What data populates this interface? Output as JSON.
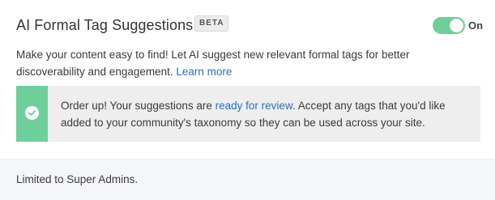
{
  "header": {
    "title": "AI Formal Tag Suggestions",
    "badge": "BETA",
    "toggle_state_label": "On",
    "toggle_on": true,
    "toggle_color": "#6fcf9b"
  },
  "description": {
    "text": "Make your content easy to find! Let AI suggest new relevant formal tags for better discoverability and engagement.",
    "link_label": "Learn more"
  },
  "notice": {
    "icon": "check-circle-icon",
    "text_before": "Order up! Your suggestions are",
    "link_label": "ready for review",
    "text_after": ". Accept any tags that you'd like added to your community's taxonomy so they can be used across your site.",
    "accent_color": "#6fcf9b"
  },
  "footer": {
    "text": "Limited to Super Admins."
  },
  "colors": {
    "link": "#2e6fb8",
    "notice_background": "#eeeeee",
    "footer_background": "#f5f6f8"
  }
}
